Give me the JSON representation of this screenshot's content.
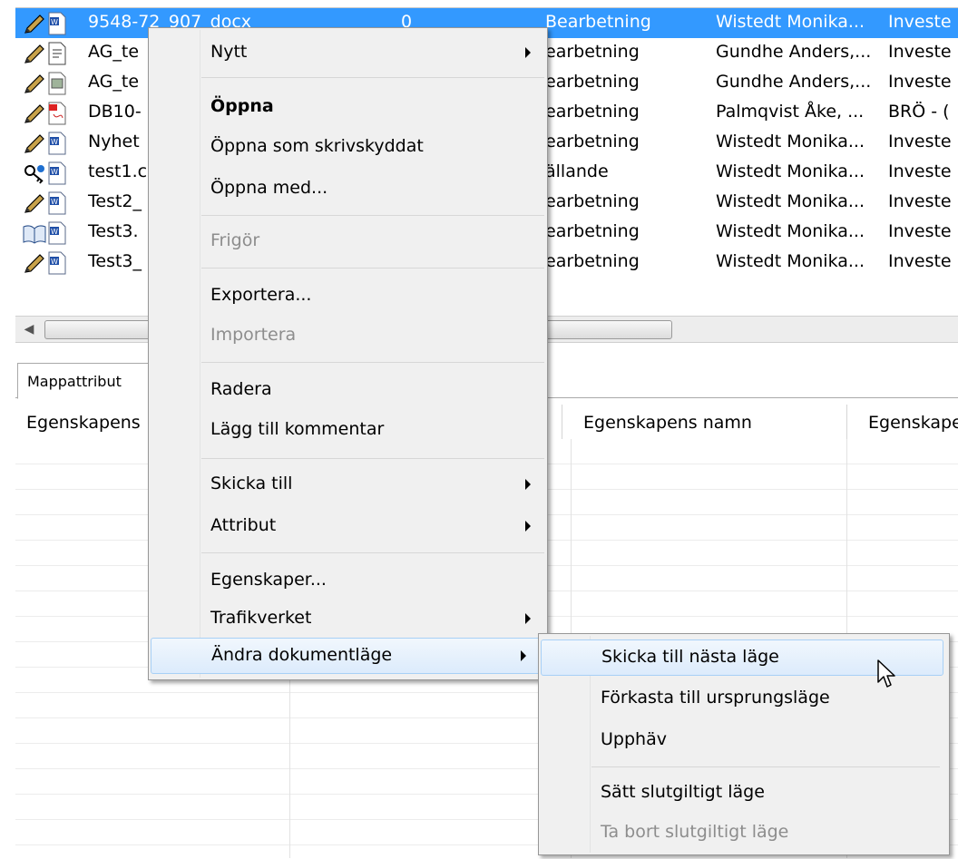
{
  "file_list": {
    "rows": [
      {
        "name": "9548-72_907_docx",
        "version": "0",
        "status": "Bearbetning",
        "user": "Wistedt Monika...",
        "project": "Investe",
        "selected": true,
        "lock": "pencil"
      },
      {
        "name": "AG_te",
        "status": "earbetning",
        "user": "Gundhe Anders,...",
        "project": "Investe",
        "lock": "pencil"
      },
      {
        "name": "AG_te",
        "status": "earbetning",
        "user": "Gundhe Anders,...",
        "project": "Investe",
        "lock": "pencil"
      },
      {
        "name": "DB10-",
        "status": "earbetning",
        "user": "Palmqvist Åke, ...",
        "project": "BRÖ - (",
        "lock": "pencil"
      },
      {
        "name": "Nyhet",
        "status": "earbetning",
        "user": "Wistedt Monika...",
        "project": "Investe",
        "lock": "pencil"
      },
      {
        "name": "test1.c",
        "status": "ällande",
        "user": "Wistedt Monika...",
        "project": "Investe",
        "lock": "key"
      },
      {
        "name": "Test2_",
        "status": "earbetning",
        "user": "Wistedt Monika...",
        "project": "Investe",
        "lock": "pencil"
      },
      {
        "name": "Test3.",
        "status": "earbetning",
        "user": "Wistedt Monika...",
        "project": "Investe",
        "lock": "book"
      },
      {
        "name": "Test3_",
        "status": "earbetning",
        "user": "Wistedt Monika...",
        "project": "Investe",
        "lock": "pencil"
      }
    ]
  },
  "lower_panel": {
    "tab_label": "Mappattribut",
    "left_header": "Egenskapens",
    "header_name": "Egenskapens namn",
    "header_value": "Egenskape"
  },
  "context_menu": {
    "items": [
      {
        "label": "Nytt",
        "submenu": true
      },
      {
        "label": "Öppna",
        "bold": true
      },
      {
        "label": "Öppna som skrivskyddat"
      },
      {
        "label": "Öppna med..."
      },
      {
        "label": "Frigör",
        "disabled": true
      },
      {
        "label": "Exportera..."
      },
      {
        "label": "Importera",
        "disabled": true
      },
      {
        "label": "Radera"
      },
      {
        "label": "Lägg till kommentar"
      },
      {
        "label": "Skicka till",
        "submenu": true
      },
      {
        "label": "Attribut",
        "submenu": true
      },
      {
        "label": "Egenskaper..."
      },
      {
        "label": "Trafikverket",
        "submenu": true
      },
      {
        "label": "Ändra dokumentläge",
        "submenu": true,
        "highlighted": true
      }
    ]
  },
  "submenu": {
    "items": [
      {
        "label": "Skicka till nästa läge",
        "highlighted": true
      },
      {
        "label": "Förkasta till ursprungsläge"
      },
      {
        "label": "Upphäv"
      },
      {
        "label": "Sätt slutgiltigt läge"
      },
      {
        "label": "Ta bort slutgiltigt läge",
        "disabled": true
      }
    ]
  },
  "colors": {
    "selection": "#3399ff",
    "menu_background": "#f0f0f0",
    "menu_highlight_border": "#a8d0f6",
    "disabled_text": "#8d8d8d"
  }
}
